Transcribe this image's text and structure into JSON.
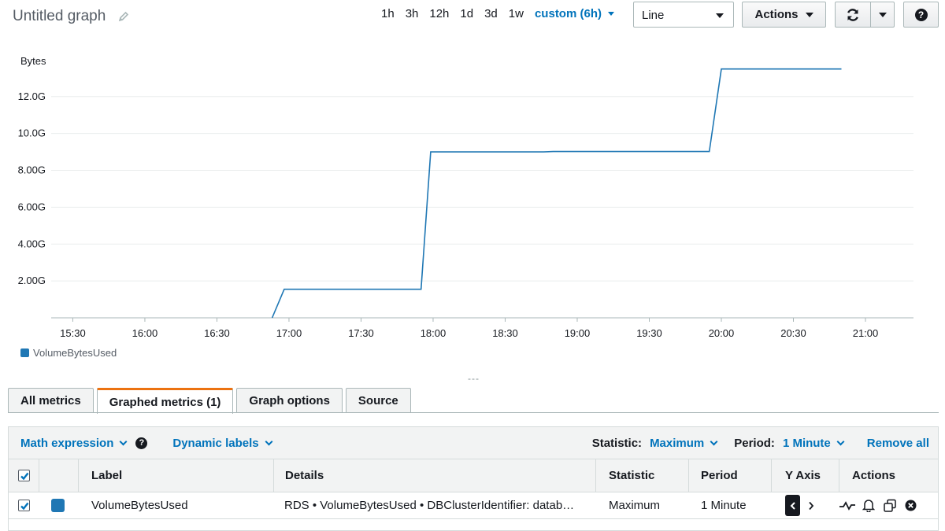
{
  "header": {
    "title": "Untitled graph",
    "time_ranges": [
      "1h",
      "3h",
      "12h",
      "1d",
      "3d",
      "1w"
    ],
    "custom_range": "custom (6h)",
    "chart_type_value": "Line",
    "actions_label": "Actions"
  },
  "chart_data": {
    "type": "line",
    "ylabel": "Bytes",
    "yticks": [
      "2.00G",
      "4.00G",
      "6.00G",
      "8.00G",
      "10.0G",
      "12.0G"
    ],
    "ytick_values": [
      2,
      4,
      6,
      8,
      10,
      12
    ],
    "ylim": [
      0,
      13.4
    ],
    "xticks": [
      "15:30",
      "16:00",
      "16:30",
      "17:00",
      "17:30",
      "18:00",
      "18:30",
      "19:00",
      "19:30",
      "20:00",
      "20:30",
      "21:00"
    ],
    "xtick_minutes": [
      930,
      960,
      990,
      1020,
      1050,
      1080,
      1110,
      1140,
      1170,
      1200,
      1230,
      1260
    ],
    "xlim_minutes": [
      921,
      1280
    ],
    "grid": true,
    "legend_position": "bottom-left",
    "series": [
      {
        "name": "VolumeBytesUsed",
        "color": "#1f77b4",
        "points": [
          [
            1013,
            0
          ],
          [
            1018,
            1.55
          ],
          [
            1075,
            1.55
          ],
          [
            1079,
            9.0
          ],
          [
            1126,
            9.0
          ],
          [
            1130,
            9.02
          ],
          [
            1195,
            9.02
          ],
          [
            1200,
            13.5
          ],
          [
            1250,
            13.5
          ]
        ]
      }
    ]
  },
  "legend": {
    "label": "VolumeBytesUsed"
  },
  "tabs": [
    "All metrics",
    "Graphed metrics (1)",
    "Graph options",
    "Source"
  ],
  "toolbar": {
    "math_expression": "Math expression",
    "dynamic_labels": "Dynamic labels",
    "statistic_label": "Statistic:",
    "statistic_value": "Maximum",
    "period_label": "Period:",
    "period_value": "1 Minute",
    "remove_all": "Remove all"
  },
  "table": {
    "headers": {
      "label": "Label",
      "details": "Details",
      "statistic": "Statistic",
      "period": "Period",
      "yaxis": "Y Axis",
      "actions": "Actions"
    },
    "rows": [
      {
        "label": "VolumeBytesUsed",
        "details": "RDS • VolumeBytesUsed • DBClusterIdentifier: datab…",
        "statistic": "Maximum",
        "period": "1 Minute",
        "color": "#1f77b4"
      }
    ]
  }
}
